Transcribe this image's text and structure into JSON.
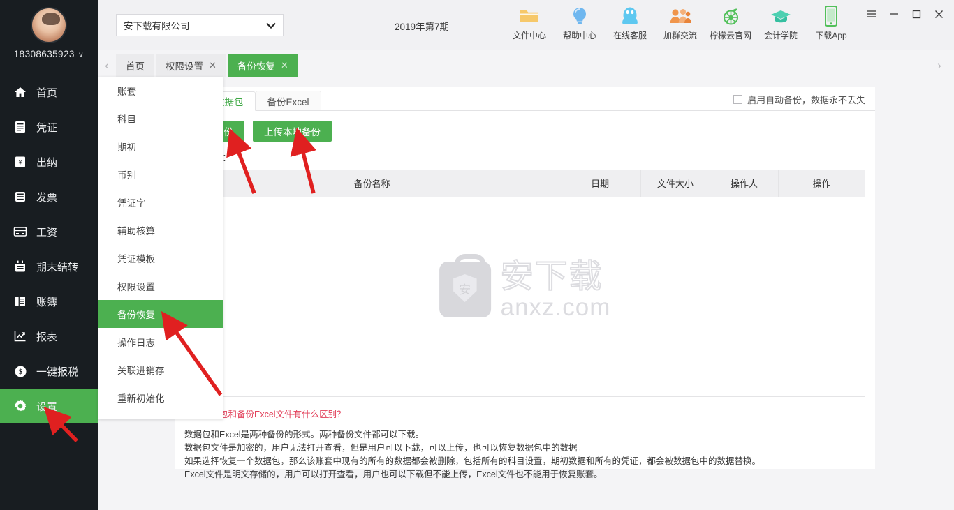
{
  "sidebar": {
    "profile": {
      "name": "18308635923",
      "caret": "∨",
      "avatar_name": "user-avatar"
    },
    "items": [
      {
        "label": "首页",
        "icon": "home-icon",
        "active": false
      },
      {
        "label": "凭证",
        "icon": "voucher-icon",
        "active": false
      },
      {
        "label": "出纳",
        "icon": "cashier-icon",
        "active": false
      },
      {
        "label": "发票",
        "icon": "invoice-icon",
        "active": false
      },
      {
        "label": "工资",
        "icon": "salary-icon",
        "active": false
      },
      {
        "label": "期末结转",
        "icon": "period-close-icon",
        "active": false
      },
      {
        "label": "账簿",
        "icon": "ledger-icon",
        "active": false
      },
      {
        "label": "报表",
        "icon": "report-icon",
        "active": false
      },
      {
        "label": "一键报税",
        "icon": "tax-icon",
        "active": false
      },
      {
        "label": "设置",
        "icon": "gear-icon",
        "active": true
      }
    ]
  },
  "topbar": {
    "company": "安下载有限公司",
    "company_caret": "⌄",
    "period": "2019年第7期",
    "quicklinks": [
      {
        "label": "文件中心",
        "icon": "folder-icon",
        "color": "#f6c86a"
      },
      {
        "label": "帮助中心",
        "icon": "lightbulb-icon",
        "color": "#6fb7ef"
      },
      {
        "label": "在线客服",
        "icon": "qq-penguin-icon",
        "color": "#5ec8f0"
      },
      {
        "label": "加群交流",
        "icon": "group-icon",
        "color": "#f0954b"
      },
      {
        "label": "柠檬云官网",
        "icon": "lemon-icon",
        "color": "#52c05a"
      },
      {
        "label": "会计学院",
        "icon": "graduation-cap-icon",
        "color": "#4dd0b1"
      },
      {
        "label": "下载App",
        "icon": "phone-icon",
        "color": "#52c05a"
      }
    ],
    "window_controls": [
      {
        "name": "menu-icon",
        "glyph": "≡"
      },
      {
        "name": "minimize-icon",
        "glyph": "–"
      },
      {
        "name": "maximize-icon",
        "glyph": "□"
      },
      {
        "name": "close-icon",
        "glyph": "✕"
      }
    ]
  },
  "tabstrip": {
    "left_arrow": "‹",
    "right_arrow": "›",
    "tabs": [
      {
        "label": "首页",
        "closable": false,
        "active": false
      },
      {
        "label": "权限设置",
        "closable": true,
        "active": false
      },
      {
        "label": "备份恢复",
        "closable": true,
        "active": true
      }
    ],
    "close_glyph": "✕"
  },
  "dropdown": {
    "items": [
      {
        "label": "账套",
        "active": false
      },
      {
        "label": "科目",
        "active": false
      },
      {
        "label": "期初",
        "active": false
      },
      {
        "label": "币别",
        "active": false
      },
      {
        "label": "凭证字",
        "active": false
      },
      {
        "label": "辅助核算",
        "active": false
      },
      {
        "label": "凭证模板",
        "active": false
      },
      {
        "label": "权限设置",
        "active": false
      },
      {
        "label": "备份恢复",
        "active": true
      },
      {
        "label": "操作日志",
        "active": false
      },
      {
        "label": "关联进销存",
        "active": false
      },
      {
        "label": "重新初始化",
        "active": false
      }
    ]
  },
  "content": {
    "inner_tabs": [
      {
        "label": "备份数据包",
        "active": true
      },
      {
        "label": "备份Excel",
        "active": false
      }
    ],
    "auto_backup_label": "启用自动备份，数据永不丢失",
    "auto_backup_checked": false,
    "buttons": [
      {
        "label": "立即备份",
        "name": "backup-now-button"
      },
      {
        "label": "上传本地备份",
        "name": "upload-local-backup-button"
      }
    ],
    "records_label": "备份记录：",
    "table": {
      "columns": [
        "备份名称",
        "日期",
        "文件大小",
        "操作人",
        "操作"
      ],
      "rows": []
    },
    "watermark": {
      "cn": "安下载",
      "en": "anxz.com",
      "badge_char": "安"
    },
    "notes": {
      "question": "备份数据包和备份Excel文件有什么区别？",
      "lines": [
        "数据包和Excel是两种备份的形式。两种备份文件都可以下载。",
        "数据包文件是加密的，用户无法打开查看，但是用户可以下载，可以上传，也可以恢复数据包中的数据。",
        "如果选择恢复一个数据包，那么该账套中现有的所有的数据都会被删除，包括所有的科目设置，期初数据和所有的凭证，都会被数据包中的数据替换。",
        "Excel文件是明文存储的，用户可以打开查看，用户也可以下载但不能上传，Excel文件也不能用于恢复账套。"
      ]
    }
  },
  "colors": {
    "brand_green": "#4cb050",
    "sidebar_bg": "#181d21",
    "page_bg": "#f4f4f6",
    "annotation_red": "#e02020",
    "note_red": "#e2405a"
  }
}
